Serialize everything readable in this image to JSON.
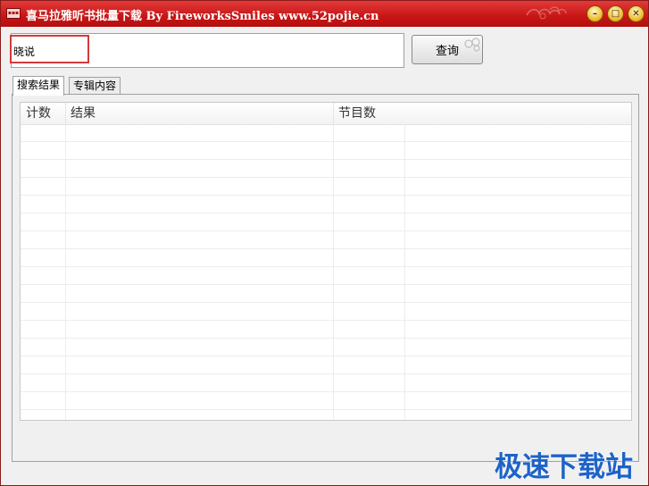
{
  "window": {
    "title": "喜马拉雅听书批量下载 By FireworksSmiles www.52pojie.cn",
    "icon": "app-icon",
    "controls": {
      "minimize": "–",
      "maximize": "□",
      "close": "✕"
    },
    "accent_color": "#c81515"
  },
  "search": {
    "value": "晓说",
    "button_label": "查询"
  },
  "tabs": [
    {
      "label": "搜索结果",
      "active": true
    },
    {
      "label": "专辑内容",
      "active": false
    }
  ],
  "results": {
    "columns": [
      "计数",
      "结果",
      "节目数"
    ],
    "rows": []
  },
  "watermark": "极速下载站"
}
